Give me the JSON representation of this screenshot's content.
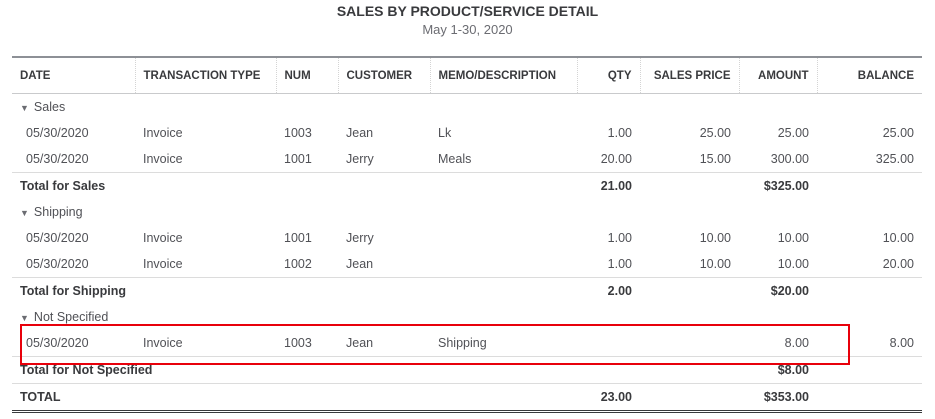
{
  "report": {
    "title": "SALES BY PRODUCT/SERVICE DETAIL",
    "date_range": "May 1-30, 2020"
  },
  "columns": [
    "DATE",
    "TRANSACTION TYPE",
    "NUM",
    "CUSTOMER",
    "MEMO/DESCRIPTION",
    "QTY",
    "SALES PRICE",
    "AMOUNT",
    "BALANCE"
  ],
  "groups": [
    {
      "name": "Sales",
      "rows": [
        [
          "05/30/2020",
          "Invoice",
          "1003",
          "Jean",
          "Lk",
          "1.00",
          "25.00",
          "25.00",
          "25.00"
        ],
        [
          "05/30/2020",
          "Invoice",
          "1001",
          "Jerry",
          "Meals",
          "20.00",
          "15.00",
          "300.00",
          "325.00"
        ]
      ],
      "total_label": "Total for Sales",
      "total_qty": "21.00",
      "total_amount": "$325.00"
    },
    {
      "name": "Shipping",
      "rows": [
        [
          "05/30/2020",
          "Invoice",
          "1001",
          "Jerry",
          "",
          "1.00",
          "10.00",
          "10.00",
          "10.00"
        ],
        [
          "05/30/2020",
          "Invoice",
          "1002",
          "Jean",
          "",
          "1.00",
          "10.00",
          "10.00",
          "20.00"
        ]
      ],
      "total_label": "Total for Shipping",
      "total_qty": "2.00",
      "total_amount": "$20.00"
    },
    {
      "name": "Not Specified",
      "rows": [
        [
          "05/30/2020",
          "Invoice",
          "1003",
          "Jean",
          "Shipping",
          "",
          "",
          "8.00",
          "8.00"
        ]
      ],
      "total_label": "Total for Not Specified",
      "total_qty": "",
      "total_amount": "$8.00"
    }
  ],
  "grand_total": {
    "label": "TOTAL",
    "qty": "23.00",
    "amount": "$353.00"
  },
  "highlight_color": "#e8000b"
}
